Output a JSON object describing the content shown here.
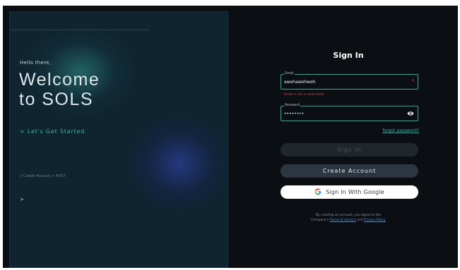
{
  "left": {
    "greeting": "Hello there,",
    "welcome_line1": "Welcome",
    "welcome_line2": "to SOLS",
    "get_started": "> Let's Get Started",
    "breadcrumb": "// Create Account > HOST",
    "prompt": ">"
  },
  "form": {
    "title": "Sign In",
    "email": {
      "label": "Email",
      "value": "awehawehweh",
      "required_mark": "*",
      "error": "Email is not a valid email"
    },
    "password": {
      "label": "Password",
      "value": "••••••••"
    },
    "forgot": "forgot password?",
    "signin_button": "Sign In",
    "create_button": "Create Account",
    "google_button": "Sign In With Google",
    "terms_prefix": "By creating an account, you agree to the",
    "terms_company": "Company's",
    "terms_link": "Terms of Service",
    "terms_and": "and",
    "privacy_link": "Privacy Policy"
  },
  "colors": {
    "accent": "#3fb9a5",
    "error": "#d64545",
    "background": "#0b0f14",
    "panel": "#0f2330"
  }
}
